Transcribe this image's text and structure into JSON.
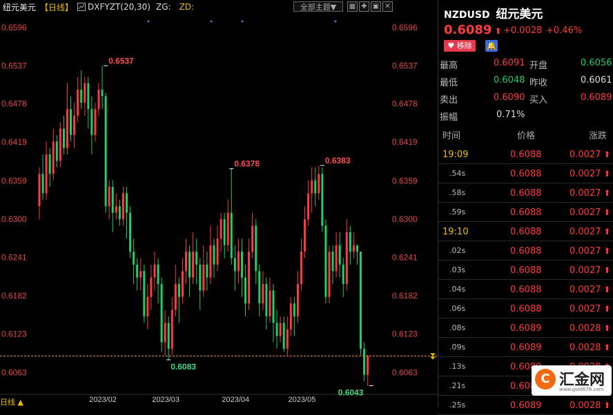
{
  "chart_header": {
    "symbol_name": "纽元美元",
    "period": "【日线】",
    "indicator": "DXFYZT(20,30)",
    "zg": "ZG:",
    "zd": "ZD:",
    "theme_select": "全部主题▼",
    "tool_icons": [
      "grid-icon",
      "cross-icon",
      "layout-icon",
      "close-icon"
    ]
  },
  "colors": {
    "up": "#ff3b3b",
    "down": "#22cc66",
    "accent": "#e8c000",
    "current_price_line": "#ff9933"
  },
  "bottom_bar": {
    "period_label": "日线 ▲"
  },
  "chart_data": {
    "type": "candlestick",
    "y_ticks": [
      "0.6596",
      "0.6537",
      "0.6478",
      "0.6419",
      "0.6359",
      "0.6300",
      "0.6241",
      "0.6182",
      "0.6123",
      "0.6063"
    ],
    "y_tick_values": [
      0.6596,
      0.6537,
      0.6478,
      0.6419,
      0.6359,
      0.63,
      0.6241,
      0.6182,
      0.6123,
      0.6063
    ],
    "ylim": [
      0.6034,
      0.6615
    ],
    "x_labels": [
      "2023/02",
      "2023/03",
      "2023/04",
      "2023/05"
    ],
    "x_label_index": [
      19,
      37,
      57,
      76
    ],
    "annotations": [
      {
        "text": "0.6537",
        "index": 19,
        "value": 0.6537,
        "kind": "high"
      },
      {
        "text": "0.6378",
        "index": 55,
        "value": 0.6378,
        "kind": "high"
      },
      {
        "text": "0.6383",
        "index": 81,
        "value": 0.6383,
        "kind": "high"
      },
      {
        "text": "0.6083",
        "index": 37,
        "value": 0.6083,
        "kind": "low"
      },
      {
        "text": "0.6043",
        "index": 95,
        "value": 0.6043,
        "kind": "low"
      }
    ],
    "current_price": 0.6089,
    "candles": [
      [
        0.632,
        0.637,
        0.638,
        0.63
      ],
      [
        0.637,
        0.634,
        0.64,
        0.633
      ],
      [
        0.634,
        0.64,
        0.642,
        0.633
      ],
      [
        0.64,
        0.637,
        0.641,
        0.635
      ],
      [
        0.637,
        0.642,
        0.644,
        0.636
      ],
      [
        0.642,
        0.639,
        0.643,
        0.638
      ],
      [
        0.639,
        0.644,
        0.645,
        0.638
      ],
      [
        0.644,
        0.641,
        0.646,
        0.64
      ],
      [
        0.641,
        0.647,
        0.651,
        0.64
      ],
      [
        0.647,
        0.643,
        0.649,
        0.642
      ],
      [
        0.643,
        0.646,
        0.648,
        0.641
      ],
      [
        0.646,
        0.65,
        0.652,
        0.645
      ],
      [
        0.65,
        0.648,
        0.653,
        0.647
      ],
      [
        0.648,
        0.651,
        0.652,
        0.646
      ],
      [
        0.651,
        0.647,
        0.652,
        0.644
      ],
      [
        0.647,
        0.643,
        0.649,
        0.64
      ],
      [
        0.643,
        0.647,
        0.648,
        0.642
      ],
      [
        0.647,
        0.65,
        0.651,
        0.646
      ],
      [
        0.65,
        0.649,
        0.6537,
        0.647
      ],
      [
        0.649,
        0.632,
        0.6495,
        0.631
      ],
      [
        0.632,
        0.635,
        0.636,
        0.63
      ],
      [
        0.635,
        0.631,
        0.636,
        0.628
      ],
      [
        0.631,
        0.632,
        0.634,
        0.63
      ],
      [
        0.632,
        0.63,
        0.633,
        0.629
      ],
      [
        0.63,
        0.634,
        0.635,
        0.629
      ],
      [
        0.634,
        0.631,
        0.635,
        0.627
      ],
      [
        0.631,
        0.625,
        0.632,
        0.624
      ],
      [
        0.625,
        0.623,
        0.627,
        0.62
      ],
      [
        0.623,
        0.621,
        0.624,
        0.619
      ],
      [
        0.621,
        0.622,
        0.624,
        0.619
      ],
      [
        0.622,
        0.615,
        0.623,
        0.614
      ],
      [
        0.615,
        0.618,
        0.62,
        0.613
      ],
      [
        0.618,
        0.621,
        0.623,
        0.616
      ],
      [
        0.621,
        0.623,
        0.625,
        0.619
      ],
      [
        0.623,
        0.62,
        0.624,
        0.617
      ],
      [
        0.62,
        0.611,
        0.621,
        0.6095
      ],
      [
        0.611,
        0.614,
        0.616,
        0.609
      ],
      [
        0.614,
        0.61,
        0.615,
        0.6083
      ],
      [
        0.61,
        0.616,
        0.618,
        0.609
      ],
      [
        0.616,
        0.62,
        0.623,
        0.615
      ],
      [
        0.62,
        0.618,
        0.621,
        0.614
      ],
      [
        0.618,
        0.622,
        0.624,
        0.617
      ],
      [
        0.622,
        0.625,
        0.627,
        0.62
      ],
      [
        0.625,
        0.621,
        0.626,
        0.618
      ],
      [
        0.621,
        0.625,
        0.628,
        0.62
      ],
      [
        0.625,
        0.623,
        0.627,
        0.62
      ],
      [
        0.623,
        0.619,
        0.624,
        0.616
      ],
      [
        0.619,
        0.623,
        0.626,
        0.618
      ],
      [
        0.623,
        0.621,
        0.625,
        0.619
      ],
      [
        0.621,
        0.626,
        0.629,
        0.62
      ],
      [
        0.626,
        0.623,
        0.627,
        0.621
      ],
      [
        0.623,
        0.627,
        0.629,
        0.622
      ],
      [
        0.627,
        0.63,
        0.631,
        0.625
      ],
      [
        0.63,
        0.626,
        0.631,
        0.624
      ],
      [
        0.626,
        0.631,
        0.633,
        0.625
      ],
      [
        0.631,
        0.624,
        0.6378,
        0.623
      ],
      [
        0.624,
        0.622,
        0.626,
        0.619
      ],
      [
        0.622,
        0.625,
        0.627,
        0.62
      ],
      [
        0.625,
        0.621,
        0.627,
        0.618
      ],
      [
        0.621,
        0.617,
        0.623,
        0.615
      ],
      [
        0.617,
        0.625,
        0.627,
        0.616
      ],
      [
        0.625,
        0.629,
        0.631,
        0.624
      ],
      [
        0.629,
        0.622,
        0.63,
        0.62
      ],
      [
        0.622,
        0.617,
        0.623,
        0.615
      ],
      [
        0.617,
        0.62,
        0.622,
        0.616
      ],
      [
        0.62,
        0.615,
        0.621,
        0.613
      ],
      [
        0.615,
        0.619,
        0.621,
        0.614
      ],
      [
        0.619,
        0.614,
        0.62,
        0.611
      ],
      [
        0.614,
        0.612,
        0.616,
        0.61
      ],
      [
        0.612,
        0.614,
        0.615,
        0.611
      ],
      [
        0.614,
        0.61,
        0.615,
        0.6095
      ],
      [
        0.61,
        0.613,
        0.615,
        0.609
      ],
      [
        0.613,
        0.617,
        0.618,
        0.612
      ],
      [
        0.617,
        0.615,
        0.618,
        0.612
      ],
      [
        0.615,
        0.62,
        0.622,
        0.614
      ],
      [
        0.62,
        0.625,
        0.627,
        0.619
      ],
      [
        0.625,
        0.63,
        0.632,
        0.624
      ],
      [
        0.63,
        0.634,
        0.636,
        0.629
      ],
      [
        0.634,
        0.636,
        0.638,
        0.631
      ],
      [
        0.636,
        0.634,
        0.638,
        0.632
      ],
      [
        0.634,
        0.637,
        0.6383,
        0.633
      ],
      [
        0.637,
        0.629,
        0.638,
        0.628
      ],
      [
        0.629,
        0.618,
        0.63,
        0.617
      ],
      [
        0.618,
        0.625,
        0.626,
        0.617
      ],
      [
        0.625,
        0.622,
        0.626,
        0.62
      ],
      [
        0.622,
        0.626,
        0.628,
        0.621
      ],
      [
        0.626,
        0.623,
        0.628,
        0.621
      ],
      [
        0.623,
        0.62,
        0.624,
        0.618
      ],
      [
        0.62,
        0.628,
        0.63,
        0.619
      ],
      [
        0.628,
        0.625,
        0.629,
        0.623
      ],
      [
        0.625,
        0.626,
        0.628,
        0.624
      ],
      [
        0.626,
        0.625,
        0.626,
        0.623
      ],
      [
        0.625,
        0.61,
        0.625,
        0.609
      ],
      [
        0.61,
        0.606,
        0.611,
        0.605
      ],
      [
        0.606,
        0.6089,
        0.6091,
        0.6043
      ]
    ]
  },
  "quote": {
    "code": "NZDUSD",
    "name": "纽元美元",
    "price": "0.6089",
    "change": "+0.0028",
    "change_pct": "+0.46%",
    "remove_label": "移除",
    "stats": {
      "high_label": "最高",
      "high": "0.6091",
      "open_label": "开盘",
      "open": "0.6056",
      "low_label": "最低",
      "low": "0.6048",
      "prev_label": "昨收",
      "prev": "0.6061",
      "sell_label": "卖出",
      "sell": "0.6090",
      "buy_label": "买入",
      "buy": "0.6089",
      "amp_label": "振幅",
      "amp": "0.71%"
    },
    "ticks_header": {
      "time": "时间",
      "price": "价格",
      "change": "涨跌"
    },
    "ticks": [
      {
        "time": "19:09",
        "major": true,
        "price": "0.6088",
        "change": "0.0027"
      },
      {
        "time": ".54s",
        "major": false,
        "price": "0.6088",
        "change": "0.0027"
      },
      {
        "time": ".58s",
        "major": false,
        "price": "0.6088",
        "change": "0.0027"
      },
      {
        "time": ".59s",
        "major": false,
        "price": "0.6088",
        "change": "0.0027"
      },
      {
        "time": "19:10",
        "major": true,
        "price": "0.6088",
        "change": "0.0027"
      },
      {
        "time": ".02s",
        "major": false,
        "price": "0.6088",
        "change": "0.0027"
      },
      {
        "time": ".03s",
        "major": false,
        "price": "0.6088",
        "change": "0.0027"
      },
      {
        "time": ".04s",
        "major": false,
        "price": "0.6088",
        "change": "0.0027"
      },
      {
        "time": ".06s",
        "major": false,
        "price": "0.6088",
        "change": "0.0027"
      },
      {
        "time": ".08s",
        "major": false,
        "price": "0.6089",
        "change": "0.0028"
      },
      {
        "time": ".09s",
        "major": false,
        "price": "0.6089",
        "change": "0.0028"
      },
      {
        "time": ".13s",
        "major": false,
        "price": "0.6089",
        "change": "0.0028"
      },
      {
        "time": ".21s",
        "major": false,
        "price": "0.6089",
        "change": "0.0028"
      },
      {
        "time": ".25s",
        "major": false,
        "price": "0.6089",
        "change": "0.0028"
      }
    ],
    "logo_text": "汇金网",
    "logo_sub": "www.gold678.com"
  }
}
